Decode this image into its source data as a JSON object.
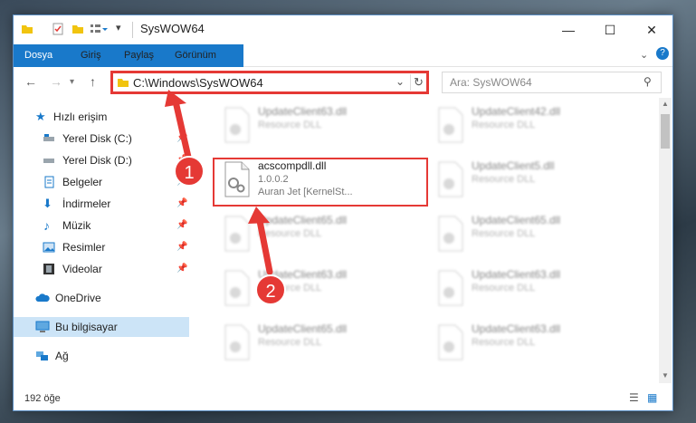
{
  "window": {
    "title": "SysWOW64"
  },
  "ribbon": {
    "tabs": [
      "Dosya",
      "Giriş",
      "Paylaş",
      "Görünüm"
    ]
  },
  "nav": {
    "address": "C:\\Windows\\SysWOW64",
    "search_placeholder": "Ara: SysWOW64"
  },
  "sidebar": {
    "items": [
      {
        "label": "Hızlı erişim",
        "icon": "star-icon"
      },
      {
        "label": "Yerel Disk (C:)",
        "icon": "drive-icon"
      },
      {
        "label": "Yerel Disk (D:)",
        "icon": "drive-icon"
      },
      {
        "label": "Belgeler",
        "icon": "documents-icon"
      },
      {
        "label": "İndirmeler",
        "icon": "download-icon"
      },
      {
        "label": "Müzik",
        "icon": "music-icon"
      },
      {
        "label": "Resimler",
        "icon": "pictures-icon"
      },
      {
        "label": "Videolar",
        "icon": "video-icon"
      },
      {
        "label": "OneDrive",
        "icon": "cloud-icon"
      },
      {
        "label": "Bu bilgisayar",
        "icon": "computer-icon"
      },
      {
        "label": "Ağ",
        "icon": "network-icon"
      }
    ]
  },
  "files": [
    {
      "name": "UpdateClient63.dll",
      "desc": "Resource DLL"
    },
    {
      "name": "UpdateClient42.dll",
      "desc": "Resource DLL"
    },
    {
      "name": "acscompdll.dll",
      "version": "1.0.0.2",
      "company": "Auran Jet [KernelSt..."
    },
    {
      "name": "UpdateClient5.dll",
      "desc": "Resource DLL"
    },
    {
      "name": "UpdateClient65.dll",
      "desc": "Resource DLL"
    },
    {
      "name": "UpdateClient65.dll",
      "desc": "Resource DLL"
    },
    {
      "name": "UpdateClient63.dll",
      "desc": "Resource DLL"
    },
    {
      "name": "UpdateClient63.dll",
      "desc": "Resource DLL"
    },
    {
      "name": "UpdateClient65.dll",
      "desc": "Resource DLL"
    },
    {
      "name": "UpdateClient63.dll",
      "desc": "Resource DLL"
    }
  ],
  "status": {
    "count": "192 öğe"
  },
  "markers": [
    "1",
    "2"
  ],
  "colors": {
    "accent": "#1979ca",
    "highlight": "#e53935"
  }
}
